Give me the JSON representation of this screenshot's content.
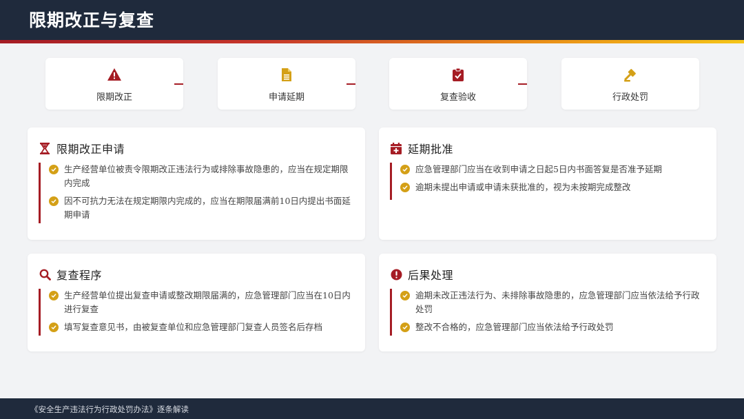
{
  "header": {
    "title": "限期改正与复查"
  },
  "colors": {
    "navy": "#1f2a3c",
    "accent_red": "#a51c24",
    "accent_gold": "#d4a017",
    "accent_orange": "#e88a18"
  },
  "steps": [
    {
      "label": "限期改正",
      "icon": "warning-triangle-icon"
    },
    {
      "label": "申请延期",
      "icon": "document-icon"
    },
    {
      "label": "复查验收",
      "icon": "clipboard-check-icon"
    },
    {
      "label": "行政处罚",
      "icon": "gavel-icon"
    }
  ],
  "cards": [
    {
      "title": "限期改正申请",
      "icon": "hourglass-icon",
      "items": [
        "生产经营单位被责令限期改正违法行为或排除事故隐患的，应当在规定期限内完成",
        "因不可抗力无法在规定期限内完成的，应当在期限届满前10日内提出书面延期申请"
      ]
    },
    {
      "title": "延期批准",
      "icon": "calendar-plus-icon",
      "items": [
        "应急管理部门应当在收到申请之日起5日内书面答复是否准予延期",
        "逾期未提出申请或申请未获批准的，视为未按期完成整改"
      ]
    },
    {
      "title": "复查程序",
      "icon": "search-icon",
      "items": [
        "生产经营单位提出复查申请或整改期限届满的，应急管理部门应当在10日内进行复查",
        "填写复查意见书，由被复查单位和应急管理部门复查人员签名后存档"
      ]
    },
    {
      "title": "后果处理",
      "icon": "exclamation-circle-icon",
      "items": [
        "逾期未改正违法行为、未排除事故隐患的，应急管理部门应当依法给予行政处罚",
        "整改不合格的，应急管理部门应当依法给予行政处罚"
      ]
    }
  ],
  "footer": {
    "text": "《安全生产违法行为行政处罚办法》逐条解读"
  }
}
